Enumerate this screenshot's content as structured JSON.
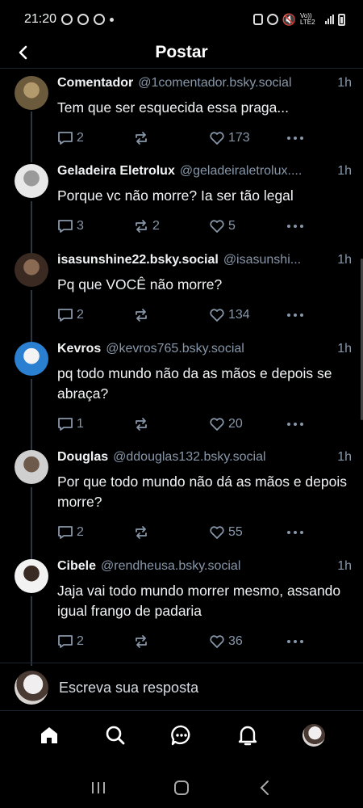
{
  "statusbar": {
    "time": "21:20",
    "network": "Vo)) LTE2"
  },
  "header": {
    "title": "Postar"
  },
  "colors": {
    "background": "#000000",
    "muted": "#8796a8",
    "text": "#f1f3f5",
    "line": "#2d3641"
  },
  "posts": [
    {
      "name": "Comentador",
      "handle": "@1comentador.bsky.social",
      "time": "1h",
      "text": "Tem que ser esquecida essa praga...",
      "replies": "2",
      "reposts": "",
      "likes": "173",
      "avatar": [
        "#6b5a3c",
        "#b39a6c"
      ]
    },
    {
      "name": "Geladeira Eletrolux",
      "handle": "@geladeiraletrolux....",
      "time": "1h",
      "text": "Porque vc não morre? Ia ser tão legal",
      "replies": "3",
      "reposts": "2",
      "likes": "5",
      "avatar": [
        "#e8e8e8",
        "#9a9a9a"
      ]
    },
    {
      "name": "isasunshine22.bsky.social",
      "handle": "@isasunshi...",
      "time": "1h",
      "text": "Pq que VOCÊ não morre?",
      "replies": "2",
      "reposts": "",
      "likes": "134",
      "avatar": [
        "#3b2a22",
        "#8a6a52"
      ]
    },
    {
      "name": "Kevros",
      "handle": "@kevros765.bsky.social",
      "time": "1h",
      "text": "pq todo mundo não da as mãos e depois se abraça?",
      "replies": "1",
      "reposts": "",
      "likes": "20",
      "avatar": [
        "#2a7fd1",
        "#f3f3f3"
      ]
    },
    {
      "name": "Douglas",
      "handle": "@ddouglas132.bsky.social",
      "time": "1h",
      "text": "Por que todo mundo não dá as mãos e depois morre?",
      "replies": "2",
      "reposts": "",
      "likes": "55",
      "avatar": [
        "#cfcfcf",
        "#6e5a4a"
      ]
    },
    {
      "name": "Cibele",
      "handle": "@rendheusa.bsky.social",
      "time": "1h",
      "text": "Jaja vai todo mundo morrer mesmo, assando igual frango de padaria",
      "replies": "2",
      "reposts": "",
      "likes": "36",
      "avatar": [
        "#f2f2f2",
        "#3a2a24"
      ]
    }
  ],
  "reply_bar": {
    "placeholder": "Escreva sua resposta"
  },
  "nav": {
    "items": [
      "home-icon",
      "search-icon",
      "chat-icon",
      "bell-icon",
      "profile-avatar"
    ]
  }
}
